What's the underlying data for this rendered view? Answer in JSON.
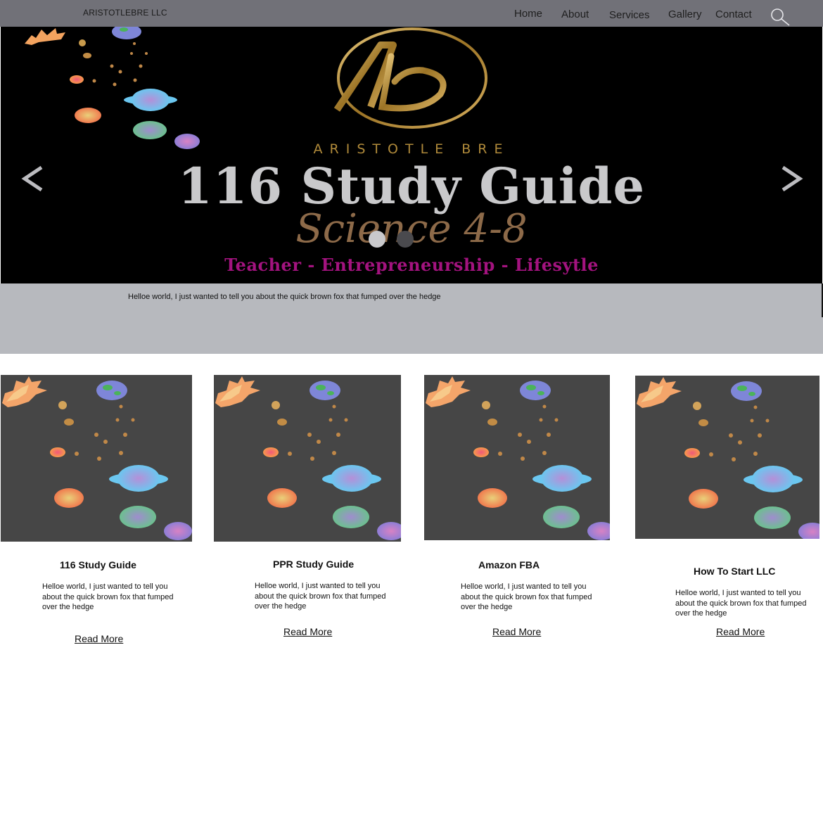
{
  "nav": {
    "brand": "ARISTOTLEBRE LLC",
    "items": [
      {
        "label": "Home"
      },
      {
        "label": "About"
      },
      {
        "label": "Services"
      },
      {
        "label": "Gallery"
      },
      {
        "label": "Contact"
      }
    ],
    "search_icon": "search-icon"
  },
  "hero": {
    "brand_text": "ARISTOTLE BRE",
    "headline": "116 Study Guide",
    "subheadline": "Science 4-8",
    "tagline": "Teacher - Entrepreneurship - Lifesytle",
    "prev_icon": "chevron-left-icon",
    "next_icon": "chevron-right-icon",
    "slide_count": 2,
    "active_slide": 1,
    "colors": {
      "gold": "#b08a3a",
      "magenta": "#a3137f",
      "silver": "#c9c9cb"
    }
  },
  "intro": {
    "text": "Helloe world, I just wanted to tell you about the quick brown fox that fumped over the hedge"
  },
  "cards": [
    {
      "title": "116 Study Guide",
      "text": "Helloe world, I just wanted to tell you about the quick brown fox that fumped over the hedge",
      "link": "Read More"
    },
    {
      "title": "PPR Study Guide",
      "text": "Helloe world, I just wanted to tell you about the quick brown fox that fumped over the hedge",
      "link": "Read More"
    },
    {
      "title": "Amazon FBA",
      "text": "Helloe world, I just wanted to tell you about the quick brown fox that fumped over the hedge",
      "link": "Read More"
    },
    {
      "title": "How To Start LLC",
      "text": "Helloe world, I just wanted to tell you about the quick brown fox that fumped over the hedge",
      "link": "Read More"
    }
  ]
}
